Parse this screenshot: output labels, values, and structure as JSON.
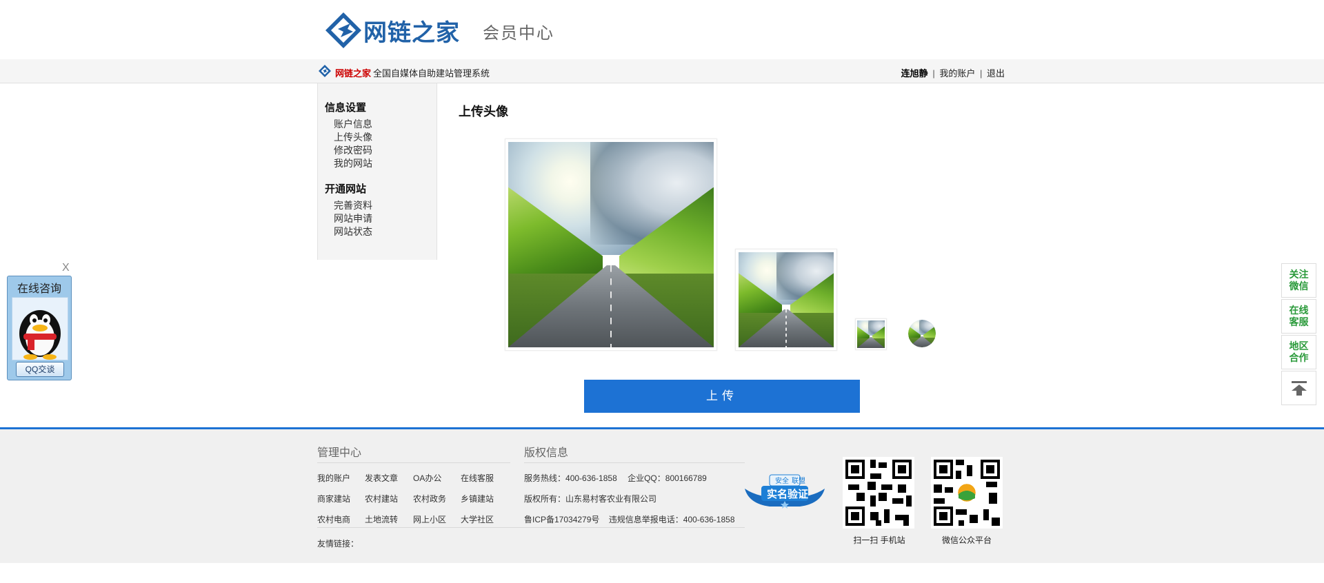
{
  "header": {
    "logo_text": "网链之家",
    "section_title": "会员中心"
  },
  "topbar": {
    "brand": "网链之家",
    "system_name": "全国自媒体自助建站管理系统",
    "username": "连旭静",
    "my_account": "我的账户",
    "logout": "退出",
    "separator": "|"
  },
  "sidebar": {
    "groups": [
      {
        "title": "信息设置",
        "items": [
          "账户信息",
          "上传头像",
          "修改密码",
          "我的网站"
        ]
      },
      {
        "title": "开通网站",
        "items": [
          "完善资料",
          "网站申请",
          "网站状态"
        ]
      }
    ]
  },
  "main": {
    "title": "上传头像",
    "upload_label": "上传"
  },
  "qq_widget": {
    "close": "X",
    "title": "在线咨询",
    "chat_button": "QQ交谈"
  },
  "rightbar": {
    "items": [
      "关注微信",
      "在线客服",
      "地区合作"
    ],
    "top_icon": "arrow-up-icon"
  },
  "footer": {
    "mgmt_title": "管理中心",
    "mgmt_links": [
      [
        "我的账户",
        "发表文章",
        "OA办公",
        "在线客服"
      ],
      [
        "商家建站",
        "农村建站",
        "农村政务",
        "乡镇建站"
      ],
      [
        "农村电商",
        "土地流转",
        "网上小区",
        "大学社区"
      ]
    ],
    "friend_links": "友情链接：",
    "copyright_title": "版权信息",
    "service_label": "服务热线：",
    "service_phone": "400-636-1858",
    "qq_label": "企业QQ：",
    "qq_number": "800166789",
    "owner_label": "版权所有：",
    "owner": "山东易村客农业有限公司",
    "icp": "鲁ICP备17034279号",
    "report_label": "违规信息举报电话：",
    "report_phone": "400-636-1858",
    "badge_top": "安全",
    "badge_mid": "联盟",
    "badge_text": "实名验证",
    "qr1_caption": "扫一扫 手机站",
    "qr2_caption": "微信公众平台"
  },
  "colors": {
    "brand_blue": "#2162a8",
    "button_blue": "#1d72d4",
    "accent_green": "#2a9a3a",
    "brand_red": "#cc0000"
  }
}
